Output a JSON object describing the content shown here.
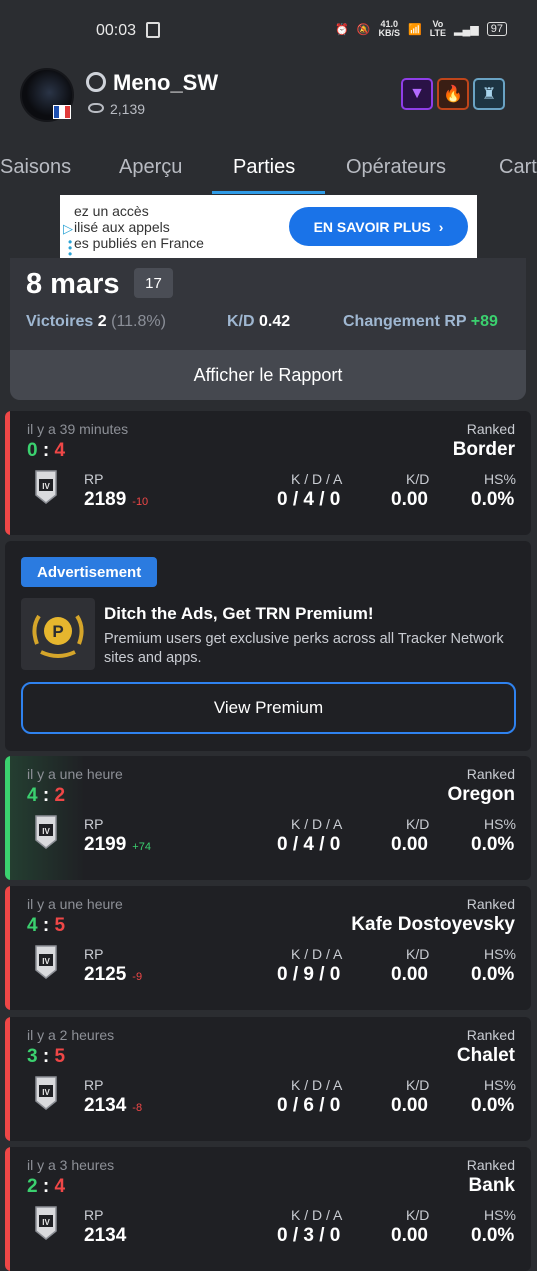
{
  "status_bar": {
    "time": "00:03",
    "net_speed": "41.0",
    "net_unit": "KB/S",
    "volte_top": "Vo",
    "volte_bottom": "LTE",
    "battery": "97"
  },
  "profile": {
    "username": "Meno_SW",
    "views": "2,139"
  },
  "badges": [
    {
      "icon": "purple-triangle-icon",
      "color": "#7a1fd6"
    },
    {
      "icon": "flame-icon",
      "color": "#c0451a"
    },
    {
      "icon": "knight-helmet-icon",
      "color": "#3a6d8c"
    }
  ],
  "tabs": [
    "Saisons",
    "Aperçu",
    "Parties",
    "Opérateurs",
    "Cart"
  ],
  "active_tab": "Parties",
  "ad_banner": {
    "line1": "ez un accès",
    "line2": "ilisé aux appels",
    "line3": "es publiés en France",
    "button": "EN SAVOIR PLUS"
  },
  "summary": {
    "date": "8 mars",
    "count": "17",
    "wins_label": "Victoires",
    "wins": "2",
    "wins_pct": "(11.8%)",
    "kd_label": "K/D",
    "kd": "0.42",
    "rp_label": "Changement RP",
    "rp_change": "+89",
    "report_button": "Afficher le Rapport"
  },
  "match_labels": {
    "rp": "RP",
    "kda": "K / D / A",
    "kd": "K/D",
    "hs": "HS%"
  },
  "matches": [
    {
      "ago": "il y a 39 minutes",
      "score_a": "0",
      "score_b": "4",
      "mode": "Ranked",
      "map": "Border",
      "rp": "2189",
      "delta": "-10",
      "kda": "0 / 4 / 0",
      "kd": "0.00",
      "hs": "0.0%",
      "result": "loss"
    },
    {
      "ago": "il y a une heure",
      "score_a": "4",
      "score_b": "2",
      "mode": "Ranked",
      "map": "Oregon",
      "rp": "2199",
      "delta": "+74",
      "kda": "0 / 4 / 0",
      "kd": "0.00",
      "hs": "0.0%",
      "result": "win"
    },
    {
      "ago": "il y a une heure",
      "score_a": "4",
      "score_b": "5",
      "mode": "Ranked",
      "map": "Kafe Dostoyevsky",
      "rp": "2125",
      "delta": "-9",
      "kda": "0 / 9 / 0",
      "kd": "0.00",
      "hs": "0.0%",
      "result": "loss"
    },
    {
      "ago": "il y a 2 heures",
      "score_a": "3",
      "score_b": "5",
      "mode": "Ranked",
      "map": "Chalet",
      "rp": "2134",
      "delta": "-8",
      "kda": "0 / 6 / 0",
      "kd": "0.00",
      "hs": "0.0%",
      "result": "loss"
    },
    {
      "ago": "il y a 3 heures",
      "score_a": "2",
      "score_b": "4",
      "mode": "Ranked",
      "map": "Bank",
      "rp": "2134",
      "delta": "",
      "kda": "0 / 3 / 0",
      "kd": "0.00",
      "hs": "0.0%",
      "result": "loss"
    }
  ],
  "premium_ad": {
    "label": "Advertisement",
    "title": "Ditch the Ads, Get TRN Premium!",
    "desc": "Premium users get exclusive perks across all Tracker Network sites and apps.",
    "button": "View Premium"
  },
  "colors": {
    "accent": "#2f9be6",
    "win": "#3bd16f",
    "loss": "#ef4747",
    "card_bg": "#1f2024",
    "page_bg": "#2b2d31"
  }
}
